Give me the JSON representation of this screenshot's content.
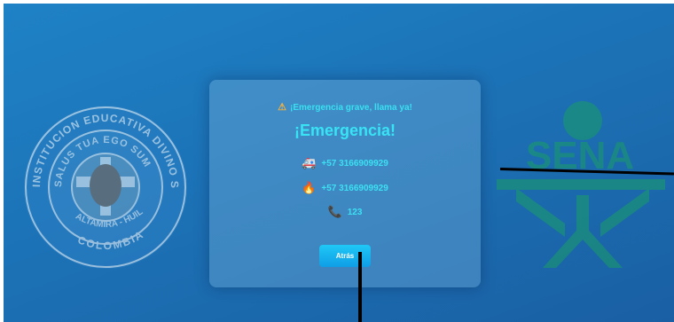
{
  "seal": {
    "ring_text": "INSTITUCION EDUCATIVA DIVINO SALVADOR",
    "motto": "SALUS TUA EGO SUM",
    "place": "ALTAMIRA - HUILA",
    "country": "COLOMBIA"
  },
  "sena": {
    "logo_text": "SENA"
  },
  "card": {
    "warning": "¡Emergencia grave, llama ya!",
    "title": "¡Emergencia!",
    "contacts": [
      {
        "icon": "ambulance-icon",
        "glyph": "🚑",
        "number": "+57 3166909929"
      },
      {
        "icon": "fire-icon",
        "glyph": "🔥",
        "number": "+57 3166909929"
      },
      {
        "icon": "phone-icon",
        "glyph": "📞",
        "number": "123"
      }
    ],
    "back_label": "Atrás"
  },
  "colors": {
    "accent": "#38e3f4",
    "button": "#1fb8f0",
    "background": "#1c72b6"
  }
}
